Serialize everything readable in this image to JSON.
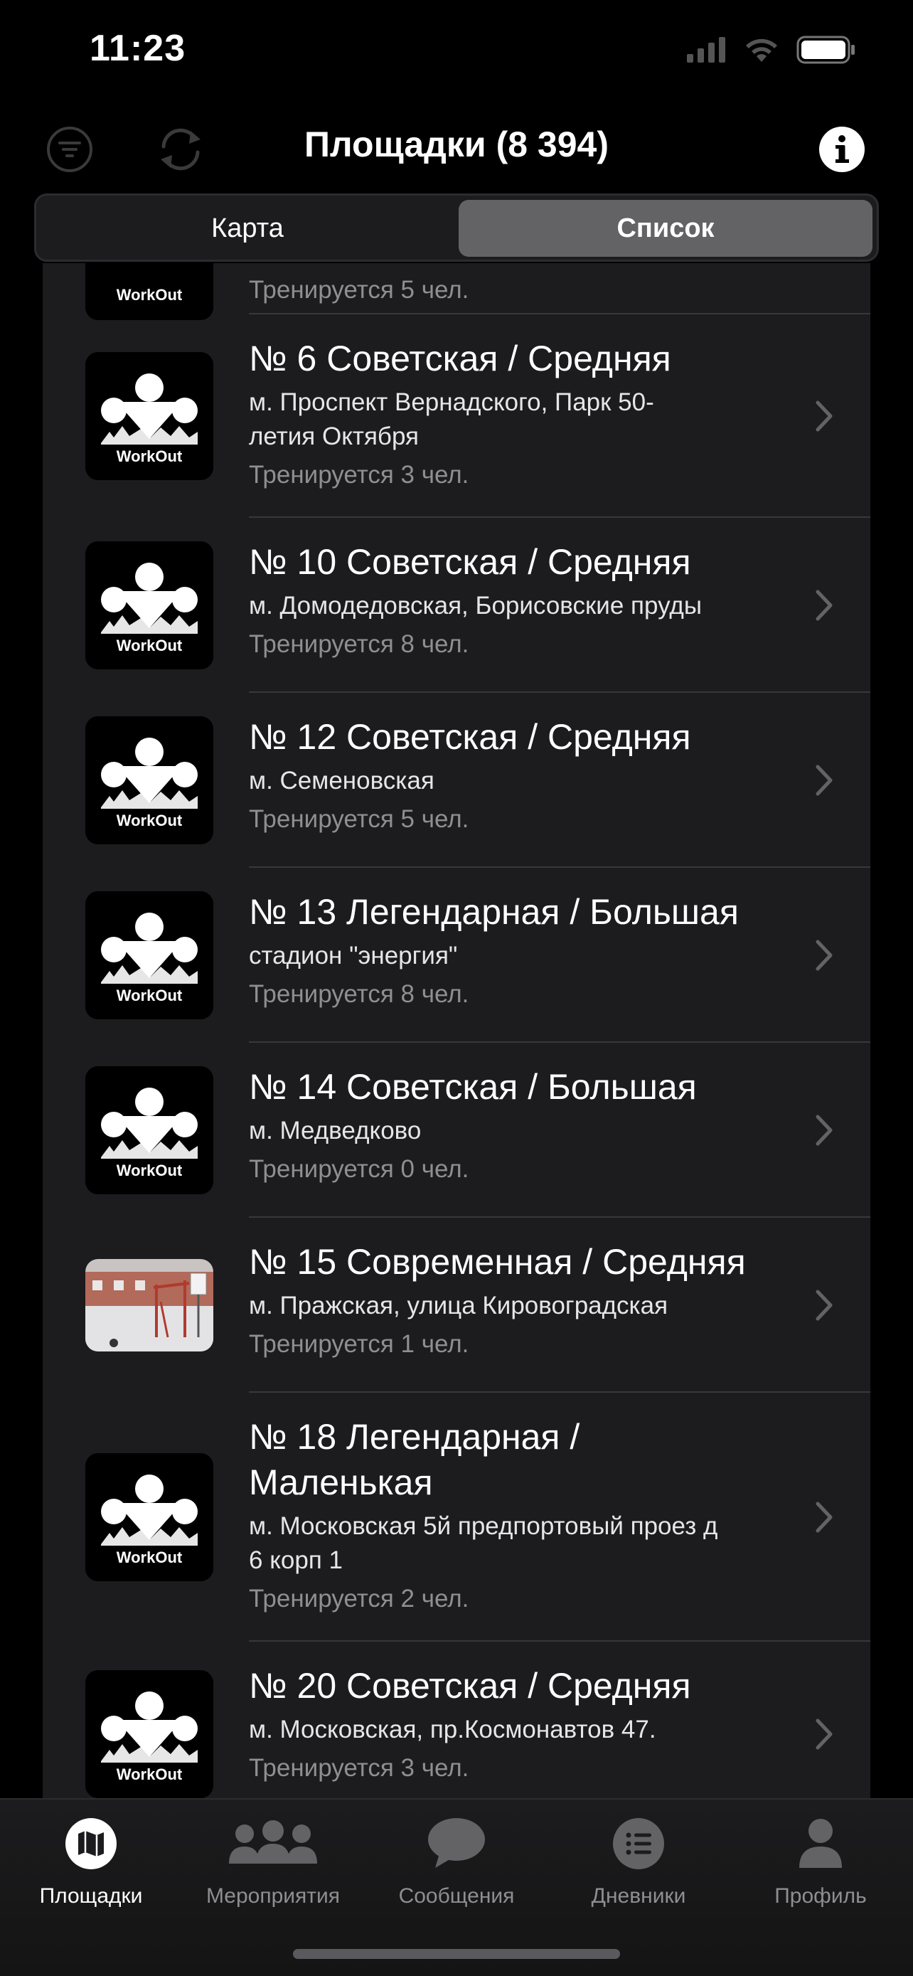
{
  "status": {
    "time": "11:23"
  },
  "nav": {
    "title": "Площадки (8 394)"
  },
  "segments": {
    "left": "Карта",
    "right": "Список"
  },
  "partial_row": {
    "count": "Тренируется 5 чел."
  },
  "rows": [
    {
      "title_lines": [
        "№ 6 Советская / Средняя"
      ],
      "addr_lines": [
        "м. Проспект Вернадского, Парк 50-",
        "летия Октября"
      ],
      "count": "Тренируется 3 чел."
    },
    {
      "title_lines": [
        "№ 10 Советская / Средняя"
      ],
      "addr_lines": [
        "м. Домодедовская, Борисовские пруды"
      ],
      "count": "Тренируется 8 чел."
    },
    {
      "title_lines": [
        "№ 12 Советская / Средняя"
      ],
      "addr_lines": [
        "м. Семеновская"
      ],
      "count": "Тренируется 5 чел."
    },
    {
      "title_lines": [
        "№ 13 Легендарная / Большая"
      ],
      "addr_lines": [
        "стадион \"энергия\""
      ],
      "count": "Тренируется 8 чел."
    },
    {
      "title_lines": [
        "№ 14 Советская / Большая"
      ],
      "addr_lines": [
        "м. Медведково"
      ],
      "count": "Тренируется 0 чел."
    },
    {
      "title_lines": [
        "№ 15 Современная / Средняя"
      ],
      "addr_lines": [
        "м. Пражская, улица Кировоградская"
      ],
      "count": "Тренируется 1 чел."
    },
    {
      "title_lines": [
        "№ 18 Легендарная /",
        "Маленькая"
      ],
      "addr_lines": [
        "м. Московская 5й предпортовый проез д",
        "6 корп 1"
      ],
      "count": "Тренируется 2 чел."
    },
    {
      "title_lines": [
        "№ 20 Советская / Средняя"
      ],
      "addr_lines": [
        "м. Московская,  пр.Космонавтов 47."
      ],
      "count": "Тренируется 3 чел."
    }
  ],
  "logo_text": "WorkOut",
  "tabs": [
    {
      "label": "Площадки",
      "icon": "map-icon"
    },
    {
      "label": "Мероприятия",
      "icon": "people-icon"
    },
    {
      "label": "Сообщения",
      "icon": "chat-bubble-icon"
    },
    {
      "label": "Дневники",
      "icon": "list-icon"
    },
    {
      "label": "Профиль",
      "icon": "person-icon"
    }
  ],
  "colors": {
    "background": "#000000",
    "cell": "#1c1c1e",
    "segment_selected": "#636366",
    "secondary_text": "#8e8e93"
  }
}
